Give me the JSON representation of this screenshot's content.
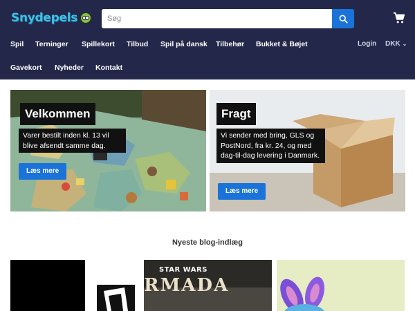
{
  "header": {
    "logo_text": "Snydepels",
    "search_placeholder": "Søg",
    "nav_row1": [
      "Spil",
      "Terninger",
      "Spillekort",
      "Tilbud",
      "Spil på dansk",
      "Tilbehør",
      "Bukket & Bøjet"
    ],
    "nav_row2": [
      "Gavekort",
      "Nyheder",
      "Kontakt"
    ],
    "login_label": "Login",
    "currency_label": "DKK"
  },
  "promos": [
    {
      "title": "Velkommen",
      "text": "Varer bestilt inden kl. 13 vil blive afsendt samme dag.",
      "button": "Læs mere"
    },
    {
      "title": "Fragt",
      "text": "Vi sender med bring, GLS og PostNord, fra kr. 24, og med dag-til-dag levering i Danmark.",
      "button": "Læs mere"
    }
  ],
  "blog": {
    "heading": "Nyeste blog-indlæg",
    "card2_logo_top": "STAR WARS",
    "card2_logo_main": "RMADA"
  },
  "colors": {
    "header_bg": "#23284a",
    "accent": "#1a73d9",
    "logo": "#3ec1e6"
  }
}
